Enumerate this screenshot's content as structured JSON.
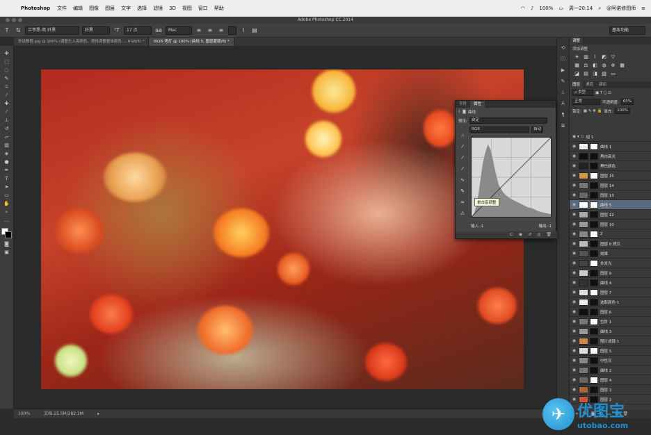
{
  "menubar": {
    "app_name": "Photoshop",
    "items": [
      "文件",
      "编辑",
      "图像",
      "图层",
      "文字",
      "选择",
      "滤镜",
      "3D",
      "视图",
      "窗口",
      "帮助"
    ],
    "battery": "100%",
    "clock": "周一20:14",
    "user": "@阿诺修图师"
  },
  "window": {
    "title": "Adobe Photoshop CC 2014"
  },
  "options": {
    "font_family": "兰亭黑-简 纤黑",
    "font_style": "纤黑",
    "font_size": "17 点",
    "aa": "Mac",
    "aa_icon": "aa",
    "workspace": "基本功能"
  },
  "tabs": [
    {
      "label": "你设教程.jpg @ 186% (调整左上亮颜色，按线调整整体颜色..., RGB/8) *",
      "active": false
    },
    {
      "label": "0026 烤灯 @ 100% (曲线 5, 图层蒙版/8) *",
      "active": true
    }
  ],
  "status": {
    "zoom": "100%",
    "doc": "文档:15.5M/282.2M"
  },
  "adjustments": {
    "tab": "调整",
    "title": "添加调整"
  },
  "layers_panel": {
    "tabs": [
      "图层",
      "通道",
      "路径"
    ],
    "blend_mode": "正常",
    "opacity_label": "不透明度:",
    "opacity": "65%",
    "lock_label": "锁定:",
    "fill_label": "填充:",
    "fill": "100%",
    "group": "组 1",
    "layers": [
      "曲线 1",
      "黑白高光",
      "黑白颜色",
      "图层 15",
      "图层 14",
      "图层 13",
      "曲线 5",
      "图层 12",
      "图层 10",
      "2",
      "图层 8 拷贝",
      "效果",
      "外发光",
      "图层 9",
      "曲线 4",
      "图层 7",
      "选取颜色 1",
      "图层 6",
      "色阶 1",
      "曲线 3",
      "照片滤镜 1",
      "图层 5",
      "中性灰",
      "曲线 2",
      "图层 4",
      "图层 3",
      "图层 2"
    ],
    "selected_index": 6
  },
  "properties": {
    "tabs": [
      "字符",
      "属性"
    ],
    "header": "曲线",
    "preset_label": "预设:",
    "preset": "自定",
    "channel": "RGB",
    "auto": "自动",
    "input_label": "输入:",
    "input_value": "-1",
    "output_label": "输出:",
    "output_value": "-1"
  },
  "tooltip": "单击后调整",
  "logo": {
    "cn": "优图宝",
    "url": "utobao.com"
  },
  "colors": {
    "photo_red": "#b32a1f",
    "selected_layer": "#5b6a7d",
    "logo_blue": "#1e8fd0"
  }
}
